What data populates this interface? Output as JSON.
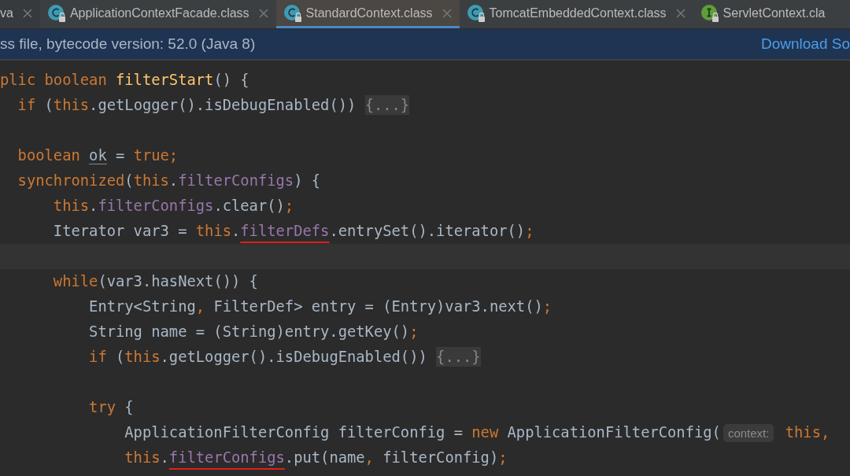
{
  "tabs": [
    {
      "label": "va",
      "kind": "plain",
      "closable": true,
      "selected": false
    },
    {
      "label": "ApplicationContextFacade.class",
      "kind": "class",
      "closable": true,
      "selected": false
    },
    {
      "label": "StandardContext.class",
      "kind": "class",
      "closable": true,
      "selected": true
    },
    {
      "label": "TomcatEmbeddedContext.class",
      "kind": "class",
      "closable": true,
      "selected": false
    },
    {
      "label": "ServletContext.cla",
      "kind": "interface",
      "closable": false,
      "selected": false
    }
  ],
  "banner": {
    "text": "ss file, bytecode version: 52.0 (Java 8)",
    "link": "Download So"
  },
  "code_lines": [
    {
      "kind": "code",
      "tokens": [
        {
          "kind": "keyword",
          "text": "plic boolean "
        },
        {
          "kind": "method",
          "text": "filterStart"
        },
        {
          "kind": "plain",
          "text": "() {"
        }
      ]
    },
    {
      "kind": "code",
      "tokens": [
        {
          "kind": "keyword",
          "text": "  if"
        },
        {
          "kind": "plain",
          "text": " ("
        },
        {
          "kind": "keyword",
          "text": "this"
        },
        {
          "kind": "plain",
          "text": ".getLogger().isDebugEnabled()) "
        },
        {
          "kind": "fold",
          "text": "{...}"
        }
      ]
    },
    {
      "kind": "blank"
    },
    {
      "kind": "code",
      "tokens": [
        {
          "kind": "keyword",
          "text": "  boolean "
        },
        {
          "kind": "variable",
          "text": "ok"
        },
        {
          "kind": "plain",
          "text": " = "
        },
        {
          "kind": "keyword",
          "text": "true;"
        }
      ]
    },
    {
      "kind": "code",
      "tokens": [
        {
          "kind": "keyword",
          "text": "  synchronized"
        },
        {
          "kind": "plain",
          "text": "("
        },
        {
          "kind": "keyword",
          "text": "this"
        },
        {
          "kind": "plain",
          "text": "."
        },
        {
          "kind": "field",
          "text": "filterConfigs"
        },
        {
          "kind": "plain",
          "text": ") {"
        }
      ]
    },
    {
      "kind": "code",
      "tokens": [
        {
          "kind": "keyword",
          "text": "      this"
        },
        {
          "kind": "plain",
          "text": "."
        },
        {
          "kind": "field",
          "text": "filterConfigs"
        },
        {
          "kind": "plain",
          "text": ".clear()"
        },
        {
          "kind": "keyword",
          "text": ";"
        }
      ]
    },
    {
      "kind": "code",
      "tokens": [
        {
          "kind": "plain",
          "text": "      Iterator var3 = "
        },
        {
          "kind": "keyword",
          "text": "this"
        },
        {
          "kind": "plain",
          "text": "."
        },
        {
          "kind": "field",
          "text": "filterDefs",
          "underlined": true
        },
        {
          "kind": "plain",
          "text": ".entrySet().iterator()"
        },
        {
          "kind": "keyword",
          "text": ";"
        }
      ]
    },
    {
      "kind": "caret"
    },
    {
      "kind": "code",
      "tokens": [
        {
          "kind": "keyword",
          "text": "      while"
        },
        {
          "kind": "plain",
          "text": "(var3.hasNext()) {"
        }
      ]
    },
    {
      "kind": "code",
      "tokens": [
        {
          "kind": "plain",
          "text": "          Entry<String"
        },
        {
          "kind": "keyword",
          "text": ","
        },
        {
          "kind": "plain",
          "text": " FilterDef> entry = (Entry)var3.next()"
        },
        {
          "kind": "keyword",
          "text": ";"
        }
      ]
    },
    {
      "kind": "code",
      "tokens": [
        {
          "kind": "plain",
          "text": "          String name = (String)entry.getKey()"
        },
        {
          "kind": "keyword",
          "text": ";"
        }
      ]
    },
    {
      "kind": "code",
      "tokens": [
        {
          "kind": "keyword",
          "text": "          if"
        },
        {
          "kind": "plain",
          "text": " ("
        },
        {
          "kind": "keyword",
          "text": "this"
        },
        {
          "kind": "plain",
          "text": ".getLogger().isDebugEnabled()) "
        },
        {
          "kind": "fold",
          "text": "{...}"
        }
      ]
    },
    {
      "kind": "blank"
    },
    {
      "kind": "code",
      "tokens": [
        {
          "kind": "keyword",
          "text": "          try"
        },
        {
          "kind": "plain",
          "text": " {"
        }
      ]
    },
    {
      "kind": "code",
      "tokens": [
        {
          "kind": "plain",
          "text": "              ApplicationFilterConfig filterConfig = "
        },
        {
          "kind": "keyword",
          "text": "new"
        },
        {
          "kind": "plain",
          "text": " ApplicationFilterConfig("
        },
        {
          "kind": "hint",
          "text": "context:"
        },
        {
          "kind": "keyword",
          "text": " this,"
        }
      ]
    },
    {
      "kind": "code",
      "tokens": [
        {
          "kind": "keyword",
          "text": "              this"
        },
        {
          "kind": "plain",
          "text": "."
        },
        {
          "kind": "field",
          "text": "filterConfigs",
          "underlined": true
        },
        {
          "kind": "plain",
          "text": ".put(name"
        },
        {
          "kind": "keyword",
          "text": ","
        },
        {
          "kind": "plain",
          "text": " filterConfig)"
        },
        {
          "kind": "keyword",
          "text": ";"
        }
      ]
    }
  ]
}
